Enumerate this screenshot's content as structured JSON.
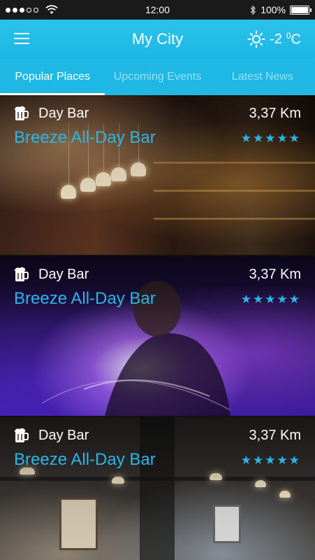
{
  "status": {
    "time": "12:00",
    "battery": "100%",
    "battery_level": 1.0,
    "signal_bars": 3,
    "signal_total": 5
  },
  "header": {
    "title": "My City",
    "temperature": "-2",
    "unit_sup": "0",
    "unit": "C"
  },
  "tabs": [
    {
      "label": "Popular Places",
      "active": true
    },
    {
      "label": "Upcoming Events",
      "active": false
    },
    {
      "label": "Latest News",
      "active": false
    }
  ],
  "places": [
    {
      "category": "Day Bar",
      "distance": "3,37 Km",
      "name": "Breeze All-Day Bar",
      "rating": 5,
      "image": "bar-interior"
    },
    {
      "category": "Day Bar",
      "distance": "3,37 Km",
      "name": "Breeze All-Day Bar",
      "rating": 5,
      "image": "dj-performance"
    },
    {
      "category": "Day Bar",
      "distance": "3,37 Km",
      "name": "Breeze All-Day Bar",
      "rating": 5,
      "image": "restaurant-room"
    }
  ],
  "colors": {
    "accent": "#1fb8e5",
    "name_text": "#2bb6ea",
    "star": "#2bb6ea"
  }
}
